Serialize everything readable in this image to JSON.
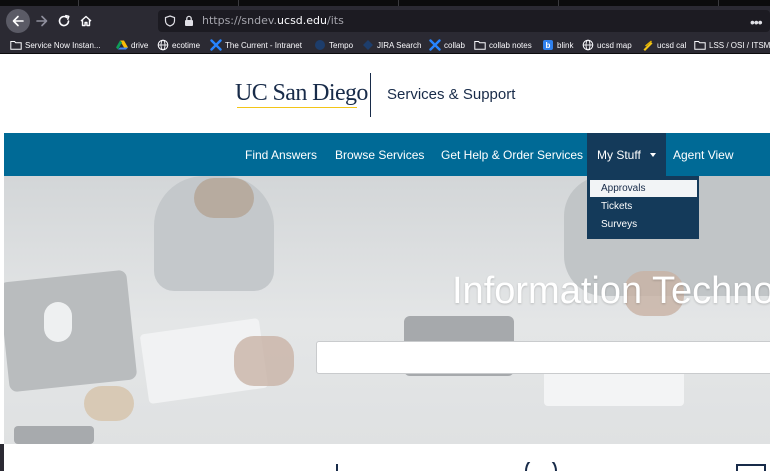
{
  "browser": {
    "url_prefix": "https://sndev.",
    "url_domain": "ucsd.edu",
    "url_path": "/its",
    "bookmarks": [
      {
        "label": "Service Now Instan...",
        "icon": "folder-icon"
      },
      {
        "label": "drive",
        "icon": "drive-icon"
      },
      {
        "label": "ecotime",
        "icon": "globe-icon"
      },
      {
        "label": "The Current - Intranet",
        "icon": "x-brand-icon"
      },
      {
        "label": "Tempo",
        "icon": "tempo-icon"
      },
      {
        "label": "JIRA Search",
        "icon": "jira-icon"
      },
      {
        "label": "collab",
        "icon": "x-brand-icon"
      },
      {
        "label": "collab notes",
        "icon": "folder-icon"
      },
      {
        "label": "blink",
        "icon": "blink-icon"
      },
      {
        "label": "ucsd map",
        "icon": "globe-icon"
      },
      {
        "label": "ucsd cal",
        "icon": "tag-icon"
      },
      {
        "label": "LSS / OSI / ITSM",
        "icon": "folder-icon"
      }
    ]
  },
  "header": {
    "logo_text": "UC San Diego",
    "tagline": "Services & Support"
  },
  "nav": {
    "items": [
      {
        "label": "Find Answers"
      },
      {
        "label": "Browse Services"
      },
      {
        "label": "Get Help & Order Services"
      },
      {
        "label": "My Stuff"
      },
      {
        "label": "Agent View"
      }
    ]
  },
  "dropdown": {
    "items": [
      {
        "label": "Approvals"
      },
      {
        "label": "Tickets"
      },
      {
        "label": "Surveys"
      }
    ]
  },
  "hero": {
    "title": "Information Techno",
    "search_placeholder": ""
  },
  "colors": {
    "nav_bg": "#006a96",
    "nav_active_bg": "#143a5a",
    "brand_navy": "#182b49",
    "brand_gold": "#f3c517"
  }
}
